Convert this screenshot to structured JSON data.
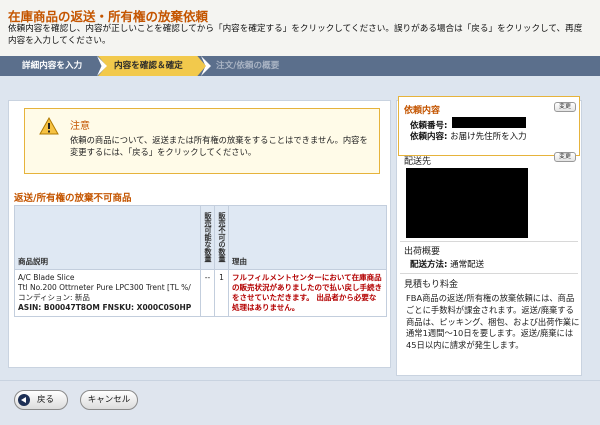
{
  "header": {
    "title": "在庫商品の返送・所有権の放棄依頼",
    "instructions": "依頼内容を確認し、内容が正しいことを確認してから「内容を確定する」をクリックしてください。誤りがある場合は「戻る」をクリックして、再度内容を入力してください。"
  },
  "steps": [
    {
      "label": "詳細内容を入力"
    },
    {
      "label": "内容を確認＆確定"
    },
    {
      "label": "注文/依頼の概要"
    }
  ],
  "notice": {
    "title": "注意",
    "body": "依頼の商品について、返送または所有権の放棄をすることはできません。内容を変更するには、「戻る」をクリックしてください。"
  },
  "section_title": "返送/所有権の放棄不可商品",
  "table": {
    "headers": {
      "product": "商品説明",
      "returnable_qty": "販売可能な数量",
      "unsellable_qty": "販売不可の数量",
      "reason": "理由"
    },
    "rows": [
      {
        "product_lines": [
          "A/C Blade Slice",
          "Ttl No.200 Ottrneter Pure LPC300 Trent [TL %/",
          "コンディション: 新品",
          "ASIN: B00047T8OM   FNSKU: X000C0S0HP"
        ],
        "returnable_qty": "--",
        "unsellable_qty": "1",
        "reason": "フルフィルメントセンターにおいて在庫商品の販売状況がありましたので払い戻し手続きをさせていただきます。  出品者から必要な処理はありません。"
      }
    ]
  },
  "sidebar": {
    "request": {
      "heading": "依頼内容",
      "edit_label": "変更",
      "number_label": "依頼番号:",
      "content_label": "依頼内容:",
      "content_value": "お届け先住所を入力"
    },
    "shipto": {
      "heading": "配送先",
      "edit_label": "変更"
    },
    "shipment": {
      "heading": "出荷概要",
      "method_label": "配送方法:",
      "method_value": "通常配送"
    },
    "estimate": {
      "heading": "見積もり料金",
      "text": "FBA商品の返送/所有権の放棄依頼には、商品ごとに手数料が課金されます。返送/廃棄する商品は、ピッキング、梱包、および出荷作業に通常1週間〜10日を要します。返送/廃棄には45日以内に請求が発生します。"
    }
  },
  "footer": {
    "back_label": "戻る",
    "cancel_label": "キャンセル"
  },
  "colors": {
    "accent_orange": "#c45500",
    "step_active": "#f2c94c",
    "step_bar": "#5b6f8c",
    "reason_red": "#b30000"
  }
}
